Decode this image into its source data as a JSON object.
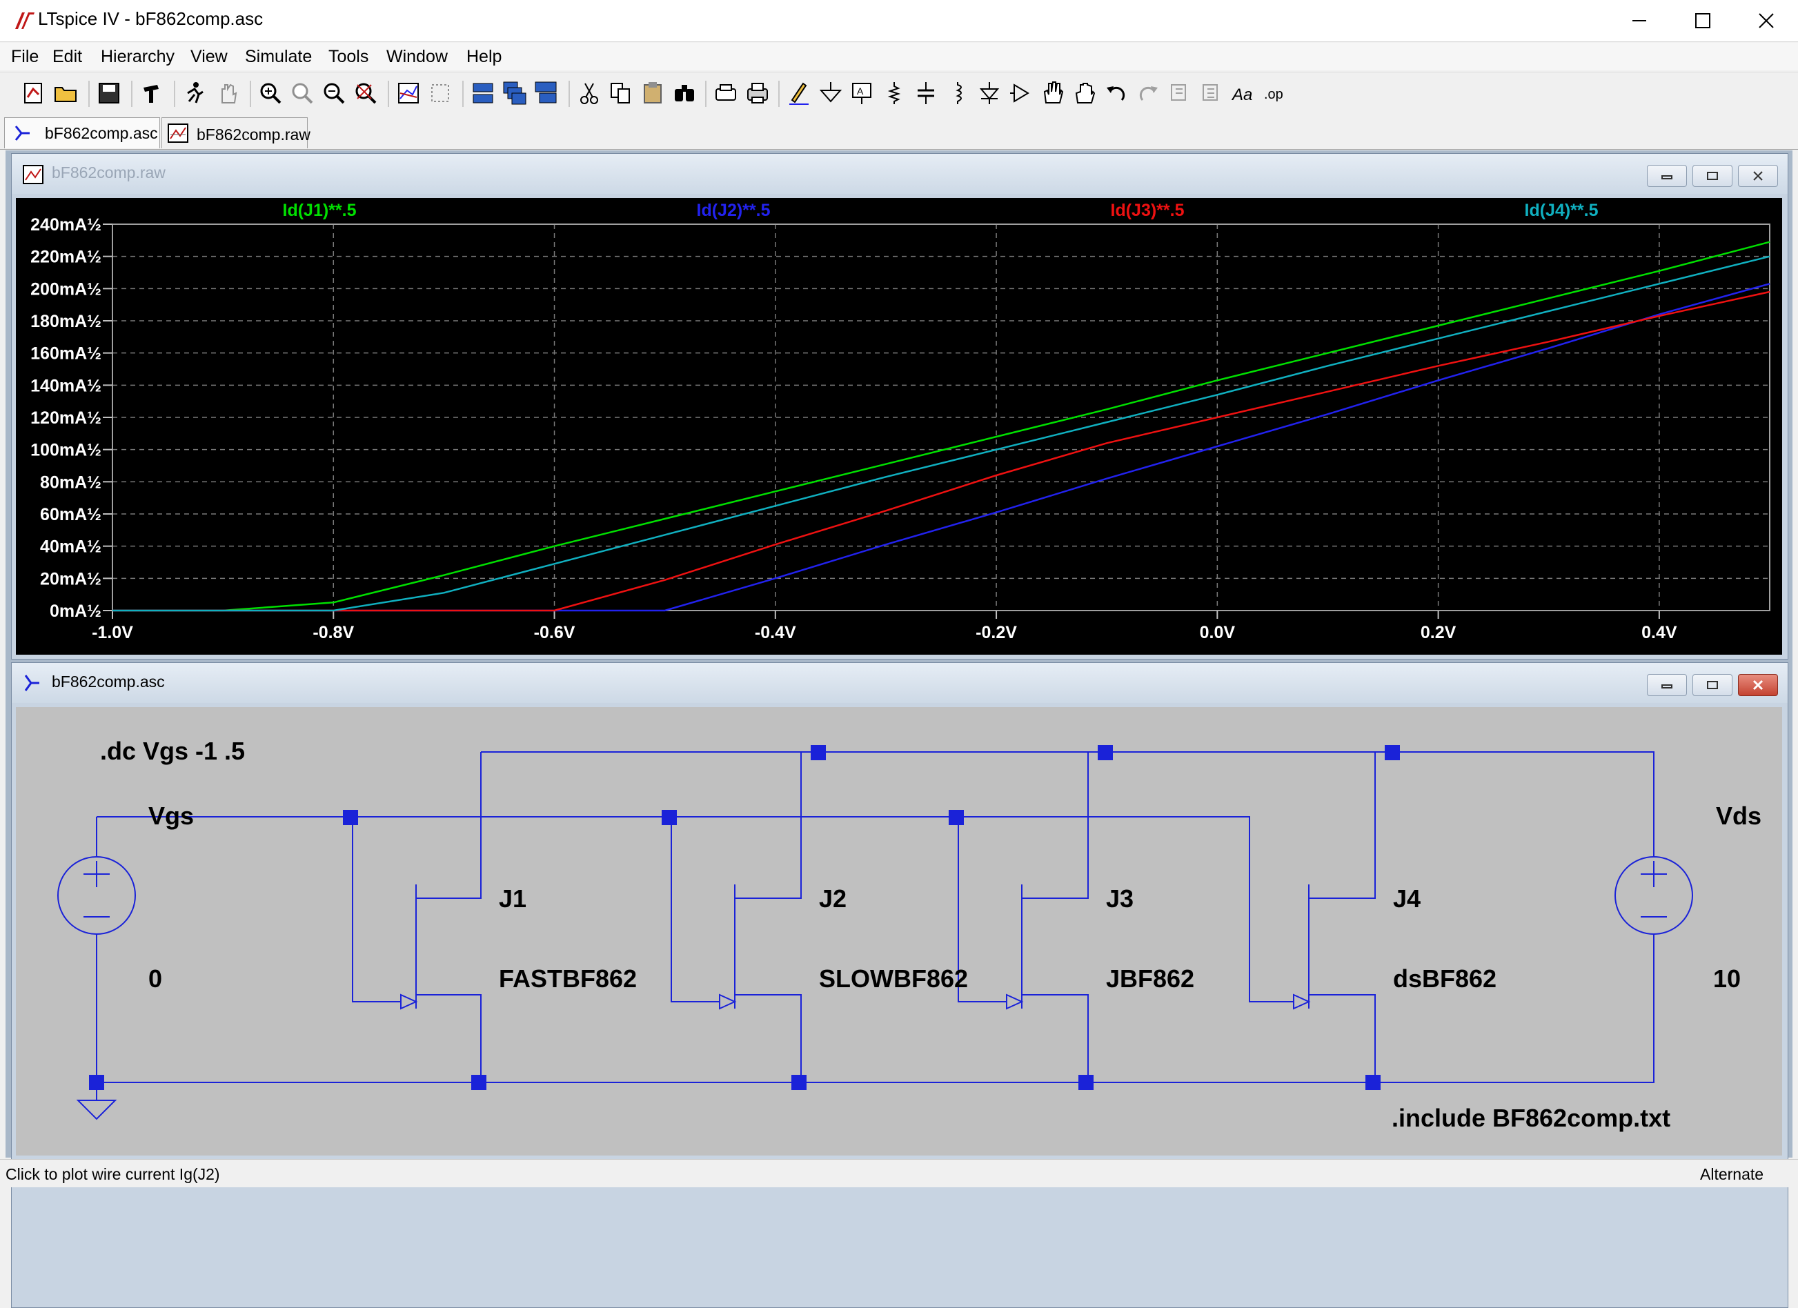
{
  "window": {
    "title": "LTspice IV - bF862comp.asc"
  },
  "menu": [
    "File",
    "Edit",
    "Hierarchy",
    "View",
    "Simulate",
    "Tools",
    "Window",
    "Help"
  ],
  "tabs": [
    {
      "label": "bF862comp.asc",
      "icon": "schematic-icon"
    },
    {
      "label": "bF862comp.raw",
      "icon": "waveform-icon"
    }
  ],
  "plot_window": {
    "title": "bF862comp.raw"
  },
  "schematic_window": {
    "title": "bF862comp.asc"
  },
  "chart_data": {
    "type": "line",
    "x": [
      -1.0,
      -0.9,
      -0.8,
      -0.7,
      -0.6,
      -0.5,
      -0.4,
      -0.3,
      -0.2,
      -0.1,
      0.0,
      0.1,
      0.2,
      0.3,
      0.4,
      0.5
    ],
    "series": [
      {
        "name": "Id(J1)**.5",
        "color": "#00e000",
        "values": [
          0,
          0,
          5,
          22,
          40,
          57,
          74,
          91,
          108,
          125,
          143,
          160,
          177,
          194,
          211,
          229
        ]
      },
      {
        "name": "Id(J2)**.5",
        "color": "#2222ee",
        "values": [
          0,
          0,
          0,
          0,
          0,
          0,
          20,
          41,
          61,
          82,
          102,
          122,
          143,
          163,
          184,
          203
        ]
      },
      {
        "name": "Id(J3)**.5",
        "color": "#ee1111",
        "values": [
          0,
          0,
          0,
          0,
          0,
          19,
          41,
          62,
          84,
          104,
          120,
          136,
          152,
          167,
          183,
          198
        ]
      },
      {
        "name": "Id(J4)**.5",
        "color": "#10b0c0",
        "values": [
          0,
          0,
          0,
          11,
          29,
          47,
          65,
          83,
          100,
          117,
          134,
          152,
          169,
          186,
          203,
          220
        ]
      }
    ],
    "x_ticks": [
      "-1.0V",
      "-0.8V",
      "-0.6V",
      "-0.4V",
      "-0.2V",
      "0.0V",
      "0.2V",
      "0.4V"
    ],
    "y_ticks": [
      "0mA½",
      "20mA½",
      "40mA½",
      "60mA½",
      "80mA½",
      "100mA½",
      "120mA½",
      "140mA½",
      "160mA½",
      "180mA½",
      "200mA½",
      "220mA½",
      "240mA½"
    ],
    "xlim": [
      -1.0,
      0.5
    ],
    "ylim": [
      0,
      240
    ],
    "grid": true,
    "legend": "top"
  },
  "schematic": {
    "directive_dc": ".dc Vgs -1 .5",
    "directive_include": ".include BF862comp.txt",
    "source_left": {
      "name": "Vgs",
      "value": "0"
    },
    "source_right": {
      "name": "Vds",
      "value": "10"
    },
    "jfets": [
      {
        "ref": "J1",
        "model": "FASTBF862"
      },
      {
        "ref": "J2",
        "model": "SLOWBF862"
      },
      {
        "ref": "J3",
        "model": "JBF862"
      },
      {
        "ref": "J4",
        "model": "dsBF862"
      }
    ],
    "wire_color": "#1a22d8",
    "background": "#c0c0c0"
  },
  "status": {
    "message": "Click to plot wire current Ig(J2)",
    "mode": "Alternate"
  }
}
